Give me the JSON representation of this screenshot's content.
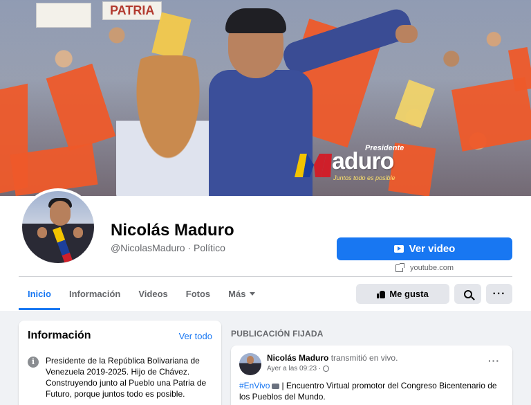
{
  "cover": {
    "sign_text": "PATRIA",
    "logo_small": "Presidente",
    "logo_word": "aduro",
    "logo_tagline": "Juntos todo es posible"
  },
  "profile": {
    "name": "Nicolás Maduro",
    "handle": "@NicolasMaduro · Político",
    "primary_button": "Ver video",
    "link_text": "youtube.com"
  },
  "tabs": [
    {
      "label": "Inicio",
      "active": true
    },
    {
      "label": "Información"
    },
    {
      "label": "Videos"
    },
    {
      "label": "Fotos"
    },
    {
      "label": "Más"
    }
  ],
  "actions": {
    "like_label": "Me gusta"
  },
  "info": {
    "title": "Información",
    "see_all": "Ver todo",
    "description": "Presidente de la República Bolivariana de Venezuela 2019-2025. Hijo de Chávez. Construyendo junto al Pueblo una Patria de Futuro, porque juntos todo es posible."
  },
  "pinned": {
    "label": "PUBLICACIÓN FIJADA",
    "author": "Nicolás Maduro",
    "action": "transmitió en vivo.",
    "time": "Ayer a las 09:23 ·",
    "hashtag": "#EnVivo",
    "text": "| Encuentro Virtual promotor del Congreso Bicentenario de los Pueblos del Mundo."
  },
  "colors": {
    "accent": "#1877f2",
    "flag": "#ee5a2a"
  }
}
